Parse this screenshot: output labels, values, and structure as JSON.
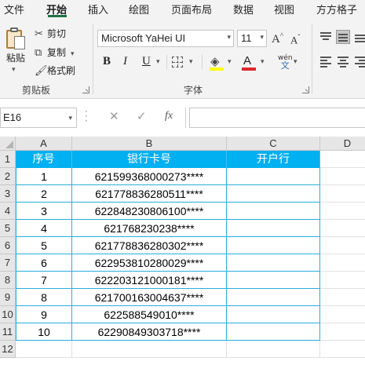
{
  "menu_tabs": [
    "文件",
    "开始",
    "插入",
    "绘图",
    "页面布局",
    "数据",
    "视图",
    "方方格子"
  ],
  "active_tab": "开始",
  "ribbon": {
    "clipboard": {
      "paste_label": "粘贴",
      "cut_label": "剪切",
      "copy_label": "复制",
      "format_painter_label": "格式刷",
      "group_label": "剪贴板"
    },
    "font": {
      "font_name": "Microsoft YaHei UI",
      "font_size": "11",
      "grow_glyph": "A",
      "shrink_glyph": "A",
      "bold_glyph": "B",
      "italic_glyph": "I",
      "underline_glyph": "U",
      "font_color_glyph": "A",
      "phonetic_glyph_top": "wén",
      "phonetic_glyph_bottom": "文",
      "group_label": "字体",
      "fill_color": "#ffff00",
      "font_color": "#e0262b"
    }
  },
  "formula_bar": {
    "name_box": "E16",
    "formula": "",
    "fx_label": "fx"
  },
  "sheet": {
    "columns": [
      "A",
      "B",
      "C",
      "D"
    ],
    "rows": [
      "1",
      "2",
      "3",
      "4",
      "5",
      "6",
      "7",
      "8",
      "9",
      "10",
      "11",
      "12"
    ],
    "header": [
      "序号",
      "银行卡号",
      "开户行"
    ],
    "header_fill": "#00b0f0",
    "data": [
      [
        "1",
        "621599368000273****",
        ""
      ],
      [
        "2",
        "621778836280511****",
        ""
      ],
      [
        "3",
        "622848230806100****",
        ""
      ],
      [
        "4",
        "621768230238****",
        ""
      ],
      [
        "5",
        "621778836280302****",
        ""
      ],
      [
        "6",
        "622953810280029****",
        ""
      ],
      [
        "7",
        "622203121000181****",
        ""
      ],
      [
        "8",
        "621700163004637****",
        ""
      ],
      [
        "9",
        "622588549010****",
        ""
      ],
      [
        "10",
        "62290849303718****",
        ""
      ]
    ]
  }
}
